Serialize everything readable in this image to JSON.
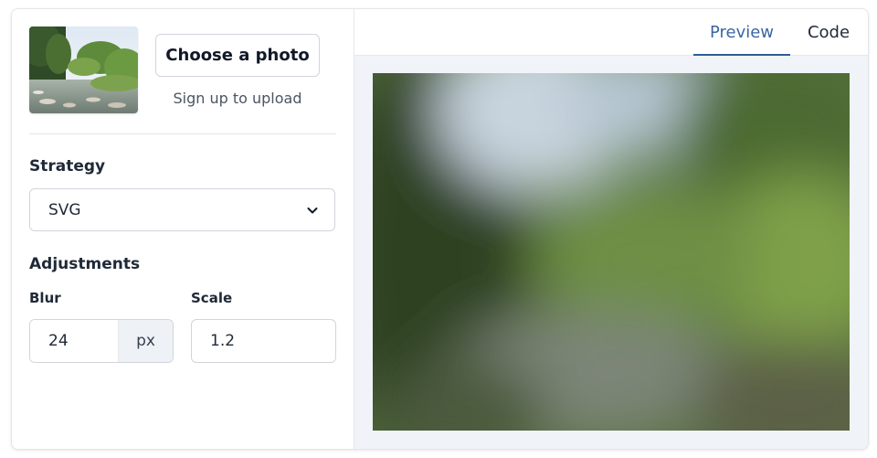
{
  "upload": {
    "choose_label": "Choose a photo",
    "signup_text": "Sign up to upload"
  },
  "strategy": {
    "label": "Strategy",
    "selected": "SVG"
  },
  "adjustments": {
    "label": "Adjustments",
    "blur": {
      "label": "Blur",
      "value": "24",
      "unit": "px"
    },
    "scale": {
      "label": "Scale",
      "value": "1.2"
    }
  },
  "tabs": {
    "preview": "Preview",
    "code": "Code",
    "active": "Preview"
  },
  "icons": {
    "select_chevron": "chevron-down-icon"
  },
  "colors": {
    "accent": "#2f5d9a",
    "panel_bg": "#f0f4f8"
  }
}
